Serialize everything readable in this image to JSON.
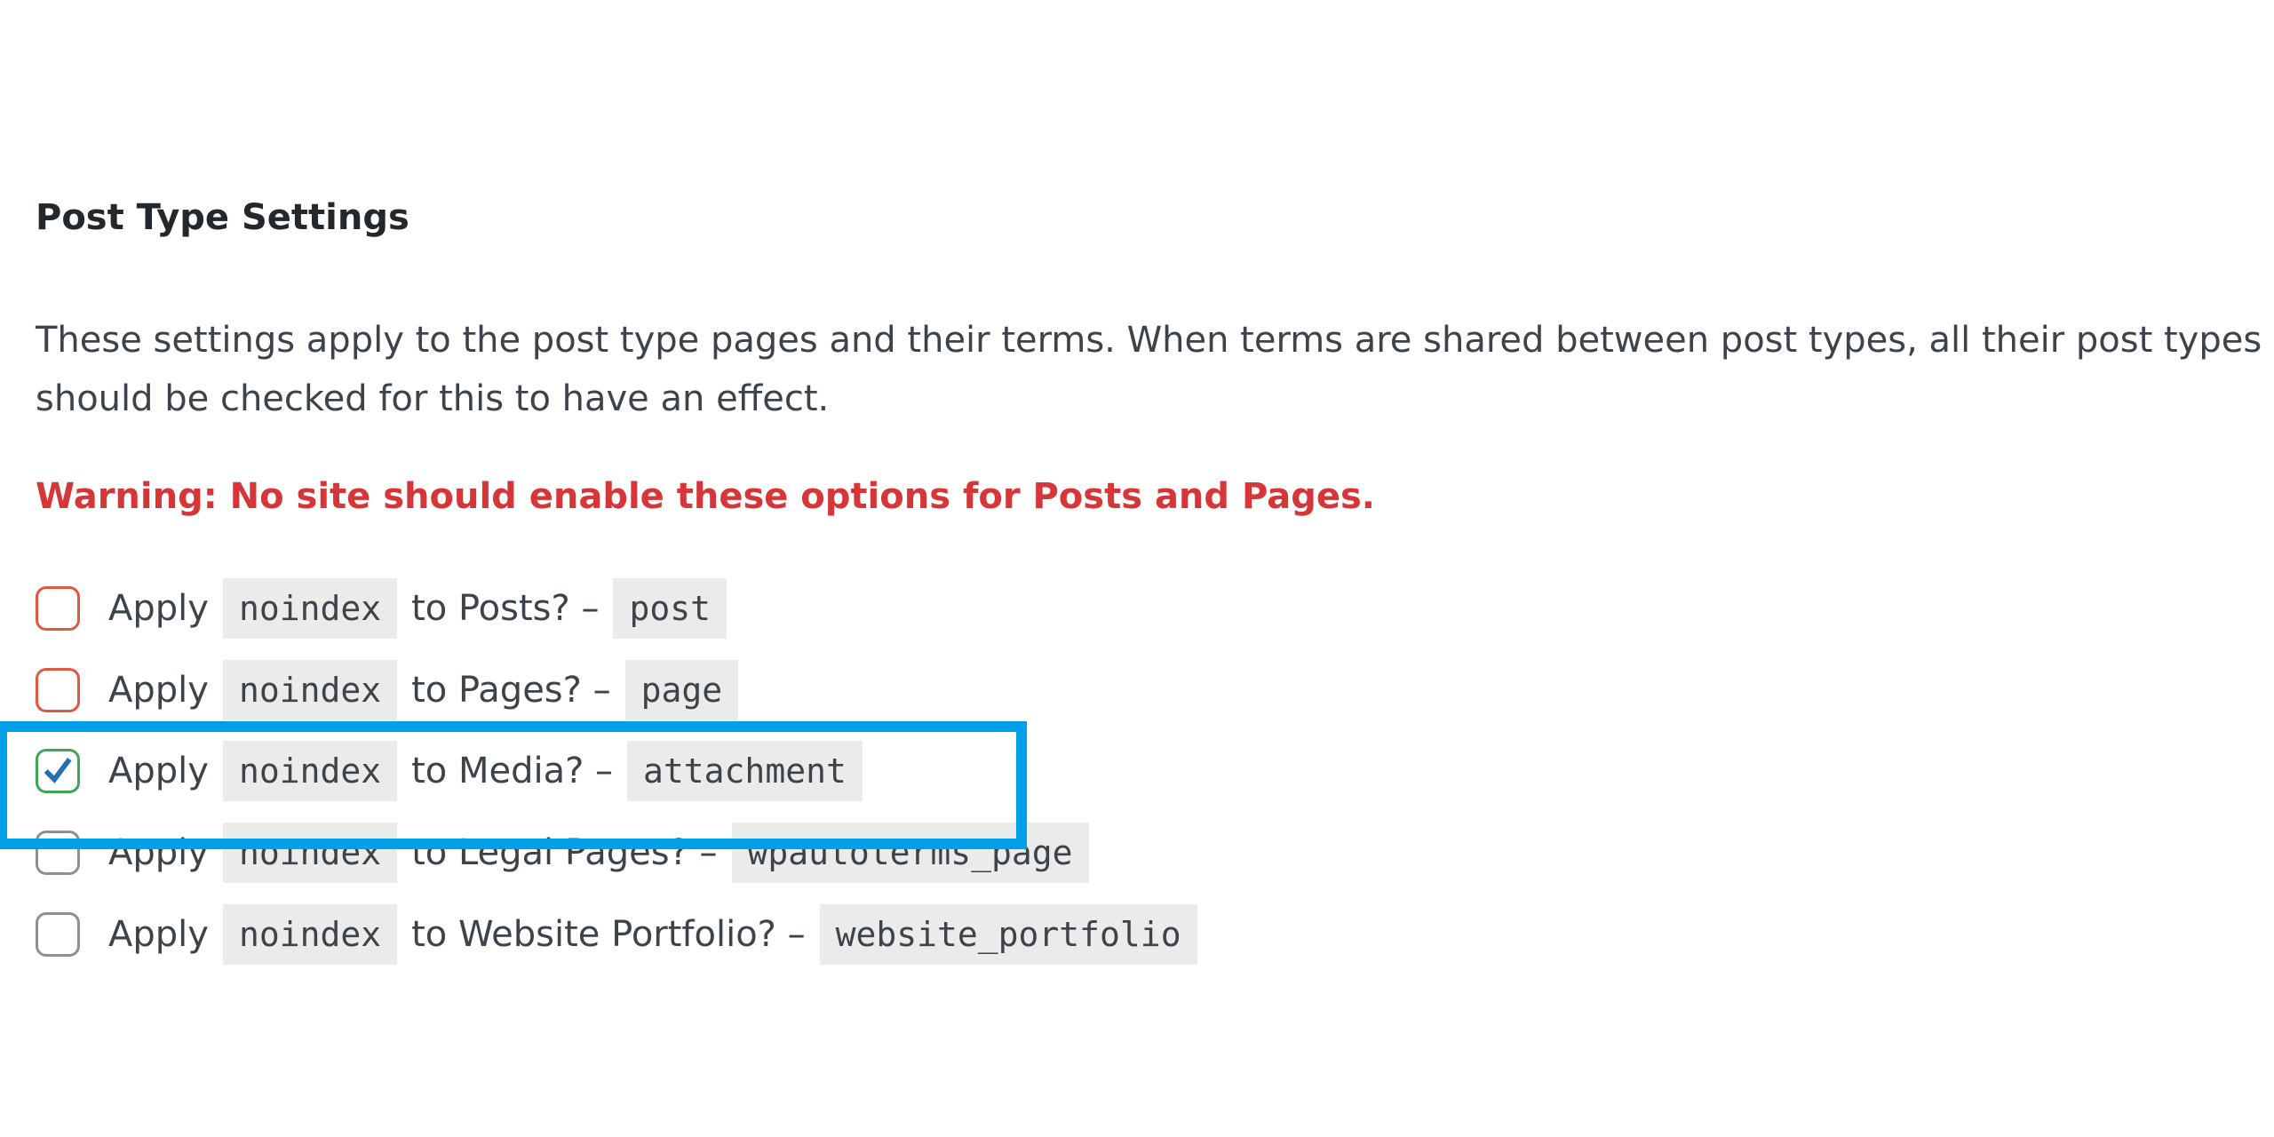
{
  "section": {
    "heading": "Post Type Settings",
    "description": "These settings apply to the post type pages and their terms. When terms are shared between post types, all their post types should be checked for this to have an effect.",
    "warning": "Warning: No site should enable these options for Posts and Pages."
  },
  "options": [
    {
      "prefix": "Apply",
      "code": "noindex",
      "label": "to Posts? –",
      "post_type": "post",
      "checked": false,
      "state": "warning"
    },
    {
      "prefix": "Apply",
      "code": "noindex",
      "label": "to Pages? –",
      "post_type": "page",
      "checked": false,
      "state": "warning"
    },
    {
      "prefix": "Apply",
      "code": "noindex",
      "label": "to Media? –",
      "post_type": "attachment",
      "checked": true,
      "state": "highlighted"
    },
    {
      "prefix": "Apply",
      "code": "noindex",
      "label": "to Legal Pages? –",
      "post_type": "wpautoterms_page",
      "checked": false,
      "state": "default"
    },
    {
      "prefix": "Apply",
      "code": "noindex",
      "label": "to Website Portfolio? –",
      "post_type": "website_portfolio",
      "checked": false,
      "state": "default"
    }
  ],
  "colors": {
    "warning": "#d63638",
    "highlight": "#00a0e9",
    "checkbox_warning": "#e2583e",
    "checkbox_checked": "#3aa757",
    "checkmark": "#2271b1"
  }
}
